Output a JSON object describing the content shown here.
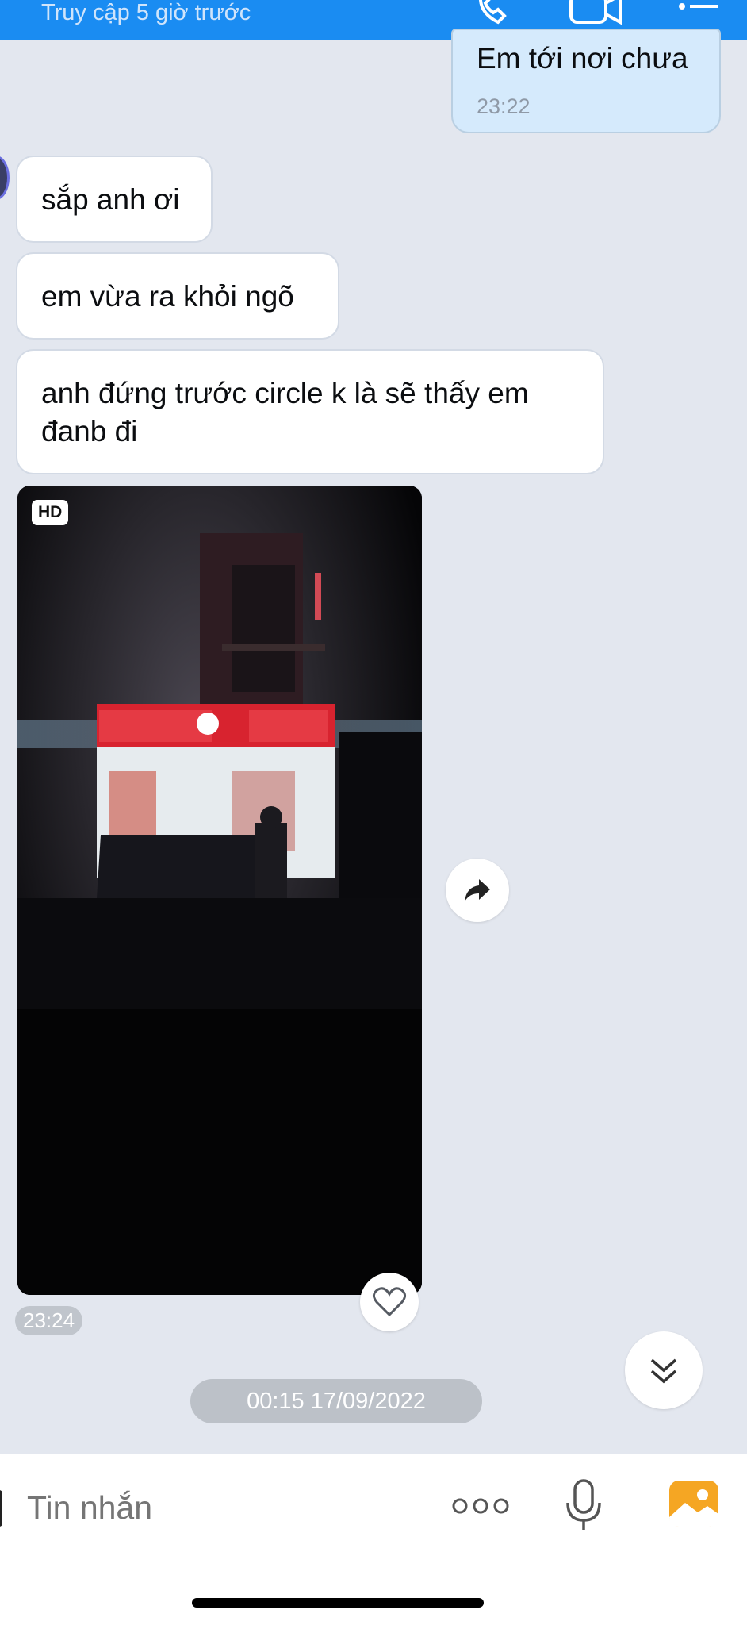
{
  "header": {
    "status": "Truy cập 5 giờ trước",
    "icons": [
      "phone-icon",
      "video-call-icon",
      "menu-icon"
    ]
  },
  "messages": [
    {
      "side": "sent",
      "text": "Em tới nơi chưa",
      "time": "23:22"
    },
    {
      "side": "received",
      "text": "sắp anh ơi"
    },
    {
      "side": "received",
      "text": "em vừa ra khỏi ngõ"
    },
    {
      "side": "received",
      "text": "anh đứng trước circle k là sẽ thấy em đanb đi"
    }
  ],
  "media": {
    "badge": "HD",
    "store_sign": "CIRCLE K",
    "time": "23:24",
    "icons": [
      "heart-icon",
      "share-icon"
    ]
  },
  "date_divider": "00:15 17/09/2022",
  "scroll_button_icon": "double-chevron-down-icon",
  "composer": {
    "placeholder": "Tin nhắn",
    "icons": [
      "more-icon",
      "microphone-icon",
      "photo-icon"
    ]
  },
  "colors": {
    "header": "#1a8cf2",
    "background": "#e3e7ef",
    "sent_bubble": "#d5eafc",
    "received_bubble": "#ffffff",
    "photo_icon": "#f5a623"
  }
}
